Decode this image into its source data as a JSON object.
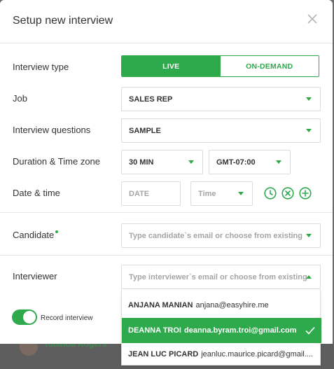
{
  "colors": {
    "accent": "#2eaa4c",
    "border": "#dcdcdc",
    "placeholder": "#a5a5a5"
  },
  "backdrop": {
    "name": "Yolanda Rogers"
  },
  "modal": {
    "title": "Setup new interview",
    "close_icon": "close-icon"
  },
  "interview_type": {
    "label": "Interview type",
    "options": [
      "LIVE",
      "ON-DEMAND"
    ],
    "selected": "LIVE"
  },
  "job": {
    "label": "Job",
    "value": "SALES REP"
  },
  "questions": {
    "label": "Interview questions",
    "value": "SAMPLE"
  },
  "duration": {
    "label": "Duration & Time zone",
    "value": "30 MIN",
    "timezone": "GMT-07:00"
  },
  "datetime": {
    "label": "Date & time",
    "date_placeholder": "DATE",
    "time_placeholder": "Time",
    "icons": [
      "clock-icon",
      "clear-icon",
      "add-icon"
    ]
  },
  "candidate": {
    "label": "Candidate",
    "placeholder": "Type candidate`s email or choose from existing"
  },
  "interviewer": {
    "label": "Interviewer",
    "placeholder": "Type interviewer`s email or choose from existing",
    "options": [
      {
        "name": "ANJANA MANIAN",
        "email": "anjana@easyhire.me",
        "selected": false
      },
      {
        "name": "DEANNA TROI",
        "email": "deanna.byram.troi@gmail.com",
        "selected": true
      },
      {
        "name": "JEAN LUC PICARD",
        "email": "jeanluc.maurice.picard@gmail....",
        "selected": false
      }
    ]
  },
  "record": {
    "label": "Record interview",
    "enabled": true
  }
}
